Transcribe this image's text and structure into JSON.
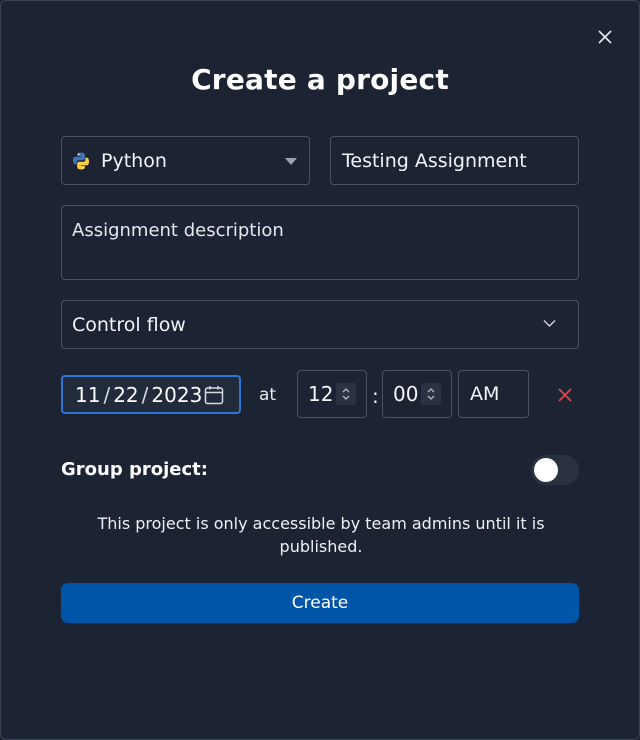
{
  "dialog": {
    "title": "Create a project",
    "language": {
      "selected": "Python",
      "icon": "python-icon"
    },
    "assignment_name": "Testing Assignment",
    "description_placeholder": "Assignment description",
    "topic": {
      "selected": "Control flow"
    },
    "due_date": {
      "month": "11",
      "day": "22",
      "year": "2023",
      "separator": "/"
    },
    "at_label": "at",
    "time": {
      "hour": "12",
      "minute": "00",
      "separator": ":",
      "period": "AM"
    },
    "group_project": {
      "label": "Group project:",
      "enabled": false
    },
    "note": "This project is only accessible by team admins until it is published.",
    "create_label": "Create"
  },
  "colors": {
    "background": "#1c2333",
    "accent": "#0055a8",
    "focus": "#2f75d6",
    "danger": "#e0474c"
  }
}
